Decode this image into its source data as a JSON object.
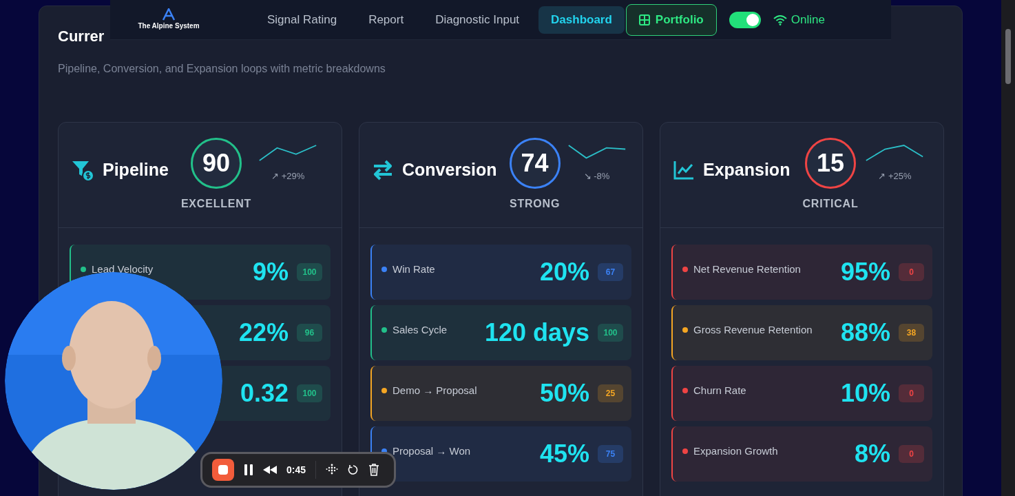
{
  "brand": {
    "name": "The Alpine System"
  },
  "nav": [
    {
      "label": "Signal Rating",
      "kind": "link",
      "selected": false
    },
    {
      "label": "Report",
      "kind": "link",
      "selected": false
    },
    {
      "label": "Diagnostic Input",
      "kind": "link",
      "selected": false
    },
    {
      "label": "Dashboard",
      "kind": "link",
      "selected": true
    },
    {
      "label": "Portfolio",
      "kind": "button",
      "selected": false
    }
  ],
  "toggle": {
    "on": true
  },
  "status": {
    "label": "Online"
  },
  "heading": "Currer",
  "subtitle": "Pipeline, Conversion, and Expansion loops with metric breakdowns",
  "cards": [
    {
      "title": "Pipeline",
      "score": "90",
      "rating": "EXCELLENT",
      "trend": "↗ +29%",
      "color": "#22c08a",
      "metrics": [
        {
          "label": "Lead Velocity",
          "value": "9%",
          "score": "100",
          "color": "#22c08a"
        },
        {
          "value": "22%",
          "score": "96",
          "color": "#22c08a"
        },
        {
          "value": "0.32",
          "score": "100",
          "color": "#22c08a"
        }
      ]
    },
    {
      "title": "Conversion",
      "score": "74",
      "rating": "STRONG",
      "trend": "↘ -8%",
      "color": "#3b82f6",
      "metrics": [
        {
          "label": "Win Rate",
          "value": "20%",
          "score": "67",
          "color": "#3b82f6"
        },
        {
          "label": "Sales Cycle",
          "value": "120 days",
          "score": "100",
          "color": "#22c08a"
        },
        {
          "label": "Demo → Proposal",
          "value": "50%",
          "score": "25",
          "color": "#f5a623"
        },
        {
          "label": "Proposal → Won",
          "value": "45%",
          "score": "75",
          "color": "#3b82f6"
        }
      ]
    },
    {
      "title": "Expansion",
      "score": "15",
      "rating": "CRITICAL",
      "trend": "↗ +25%",
      "color": "#ef4444",
      "metrics": [
        {
          "label": "Net Revenue Retention",
          "value": "95%",
          "score": "0",
          "color": "#ef4444"
        },
        {
          "label": "Gross Revenue Retention",
          "value": "88%",
          "score": "38",
          "color": "#f5a623"
        },
        {
          "label": "Churn Rate",
          "value": "10%",
          "score": "0",
          "color": "#ef4444"
        },
        {
          "label": "Expansion Growth",
          "value": "8%",
          "score": "0",
          "color": "#ef4444"
        }
      ]
    }
  ],
  "recorder": {
    "time": "0:45"
  }
}
